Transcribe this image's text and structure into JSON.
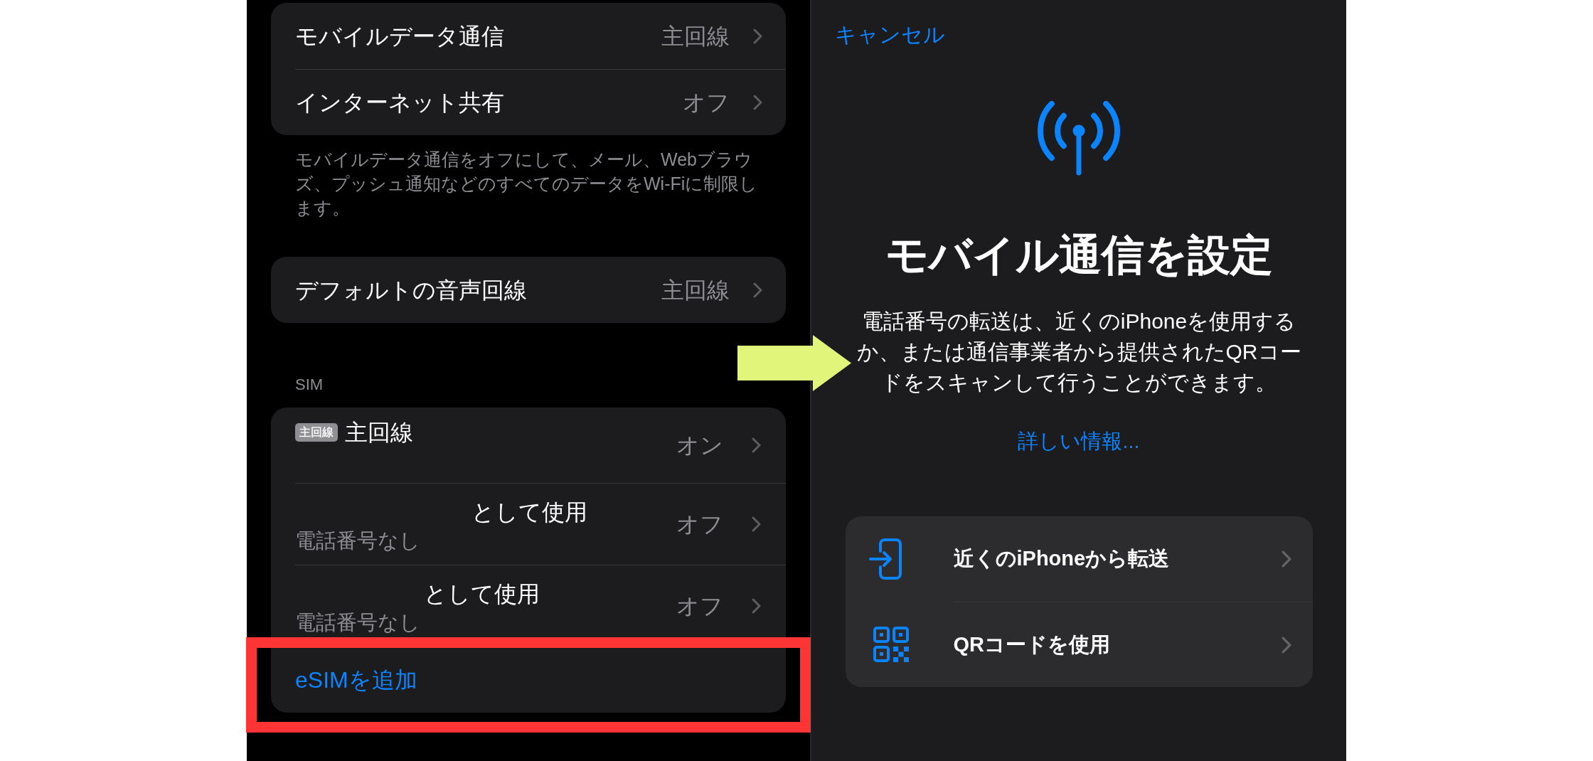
{
  "settings_screen": {
    "cellular_group": [
      {
        "label": "モバイルデータ通信",
        "value": "主回線"
      },
      {
        "label": "インターネット共有",
        "value": "オフ"
      }
    ],
    "cellular_footer": "モバイルデータ通信をオフにして、メール、Webブラウズ、プッシュ通知などのすべてのデータをWi-Fiに制限します。",
    "voice_group": [
      {
        "label": "デフォルトの音声回線",
        "value": "主回線"
      }
    ],
    "sim_header": "SIM",
    "sim_lines": [
      {
        "kind": "line",
        "badge": "主回線",
        "label": "主回線",
        "value": "オン"
      },
      {
        "kind": "line",
        "label": "として使用",
        "subtitle": "電話番号なし",
        "value": "オフ"
      },
      {
        "kind": "line",
        "label": "として使用",
        "subtitle": "電話番号なし",
        "value": "オフ"
      },
      {
        "kind": "action",
        "label": "eSIMを追加"
      }
    ]
  },
  "setup_sheet": {
    "cancel": "キャンセル",
    "title": "モバイル通信を設定",
    "description": "電話番号の転送は、近くのiPhoneを使用するか、または通信事業者から提供されたQRコードをスキャンして行うことができます。",
    "more_info": "詳しい情報...",
    "options": [
      {
        "kind": "transfer",
        "label": "近くのiPhoneから転送"
      },
      {
        "kind": "qr",
        "label": "QRコードを使用"
      }
    ]
  }
}
